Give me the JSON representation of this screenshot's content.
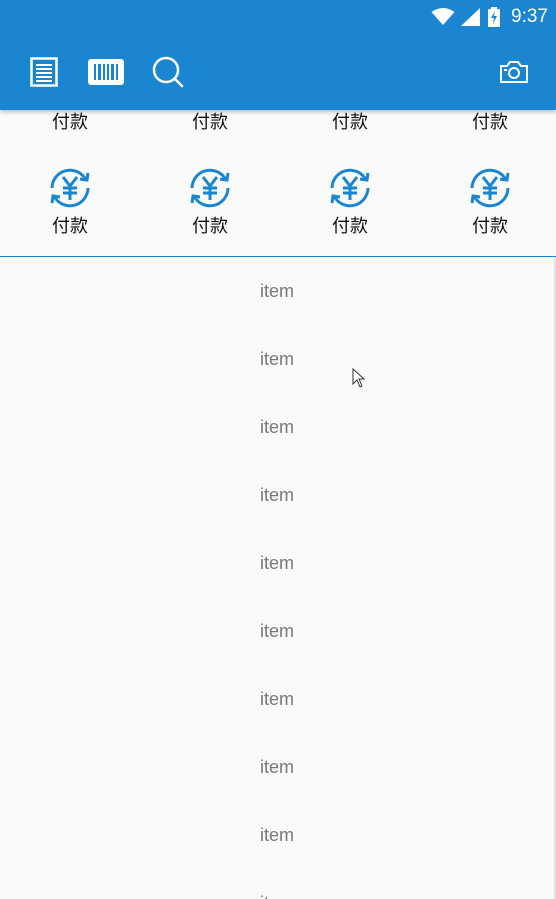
{
  "status_bar": {
    "time": "9:37",
    "icons": [
      "wifi-icon",
      "signal-icon",
      "battery-charging-icon"
    ]
  },
  "toolbar": {
    "icons": [
      "document-list-icon",
      "barcode-icon",
      "search-icon",
      "camera-icon"
    ],
    "color": "#1a86d2"
  },
  "grid": {
    "top_row_labels": [
      "付款",
      "付款",
      "付款",
      "付款"
    ],
    "items": [
      {
        "label": "付款",
        "icon": "yuan-refresh-icon"
      },
      {
        "label": "付款",
        "icon": "yuan-refresh-icon"
      },
      {
        "label": "付款",
        "icon": "yuan-refresh-icon"
      },
      {
        "label": "付款",
        "icon": "yuan-refresh-icon"
      }
    ]
  },
  "list": {
    "items": [
      "item",
      "item",
      "item",
      "item",
      "item",
      "item",
      "item",
      "item",
      "item",
      "item"
    ]
  }
}
